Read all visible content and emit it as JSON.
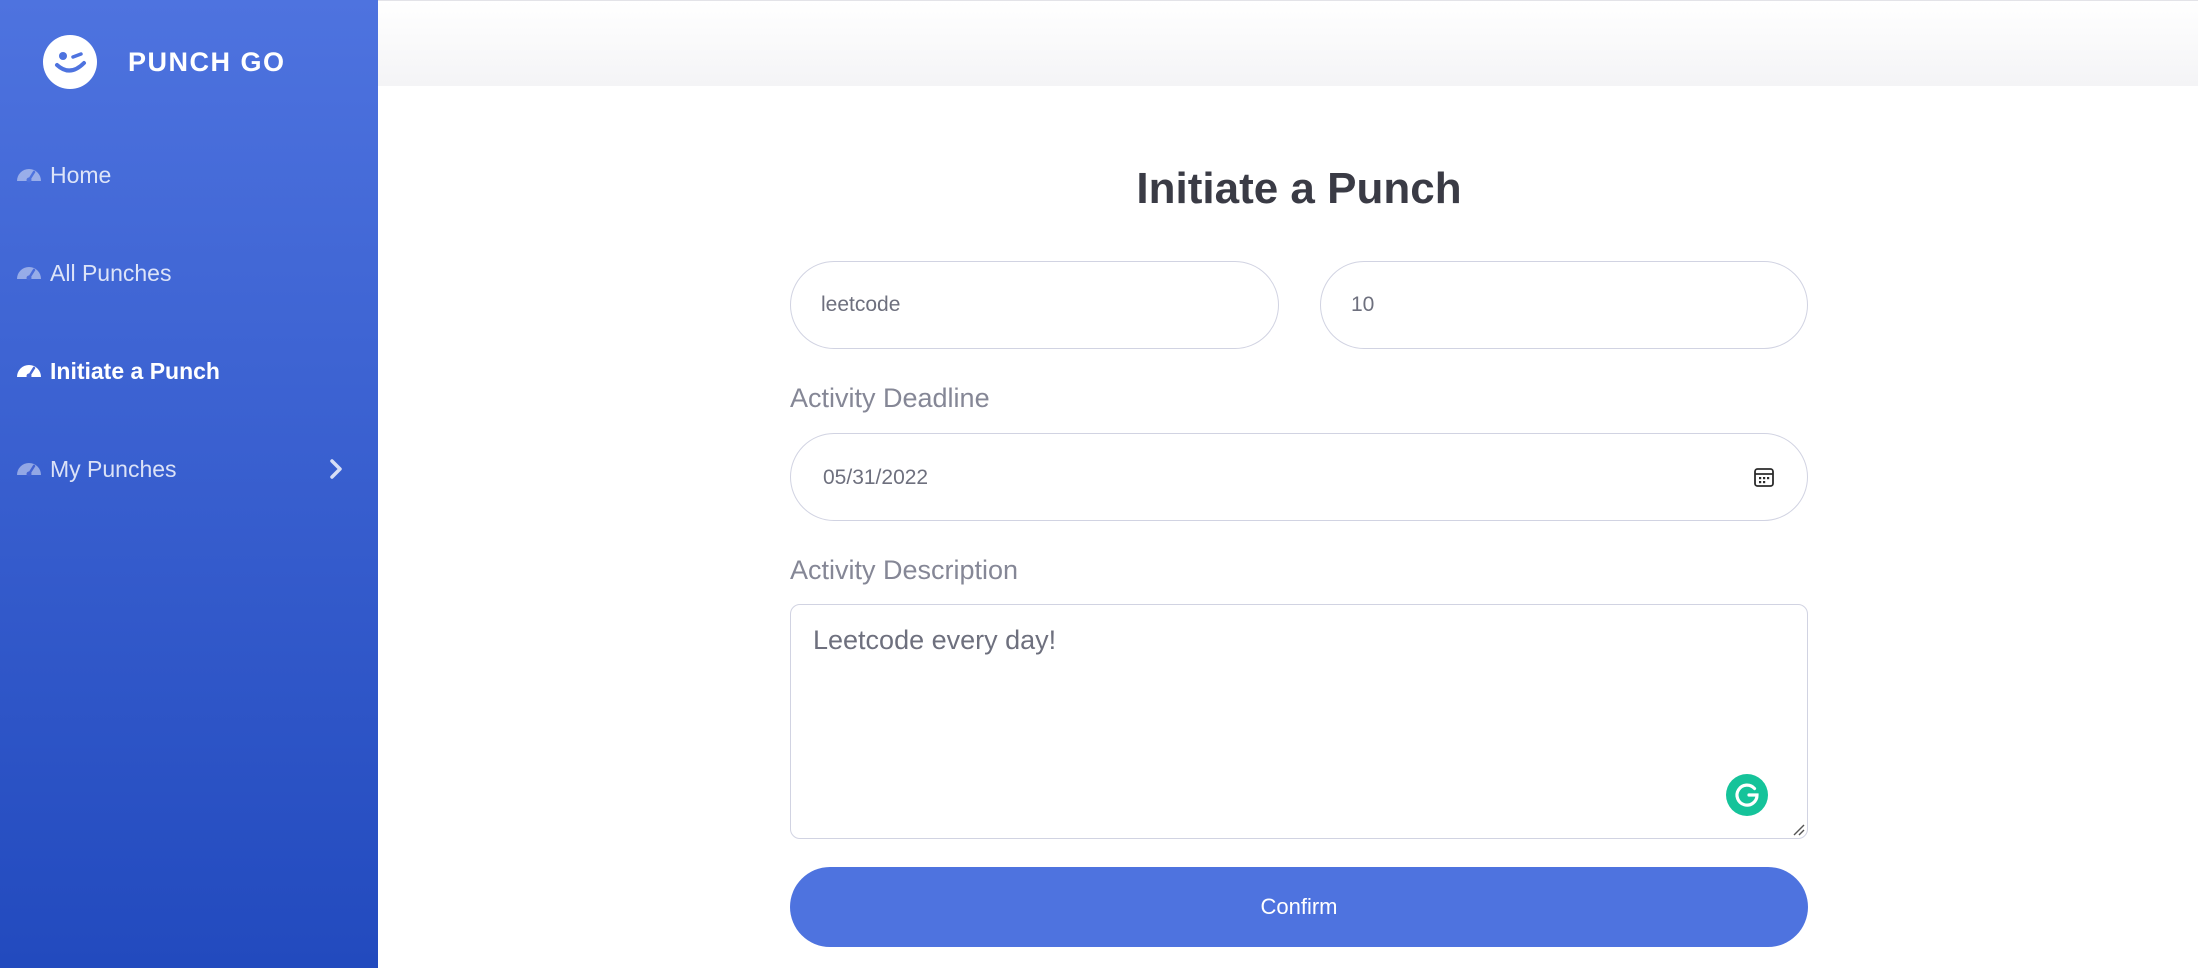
{
  "brand": {
    "name": "PUNCH GO",
    "logo_icon": "wink-face-icon"
  },
  "sidebar": {
    "items": [
      {
        "label": "Home",
        "icon": "tachometer-icon",
        "active": false
      },
      {
        "label": "All Punches",
        "icon": "tachometer-icon",
        "active": false
      },
      {
        "label": "Initiate a Punch",
        "icon": "tachometer-icon",
        "active": true
      },
      {
        "label": "My Punches",
        "icon": "tachometer-icon",
        "active": false,
        "expand_icon": "chevron-right-icon"
      }
    ]
  },
  "form": {
    "title": "Initiate a Punch",
    "name_value": "leetcode",
    "count_value": "10",
    "deadline_label": "Activity Deadline",
    "deadline_value": "05/31/2022",
    "description_label": "Activity Description",
    "description_value": "Leetcode every day!",
    "confirm_label": "Confirm"
  },
  "colors": {
    "sidebar_top": "#4e73df",
    "sidebar_bottom": "#224abe",
    "primary": "#4e73df",
    "grammarly": "#15c39a"
  }
}
